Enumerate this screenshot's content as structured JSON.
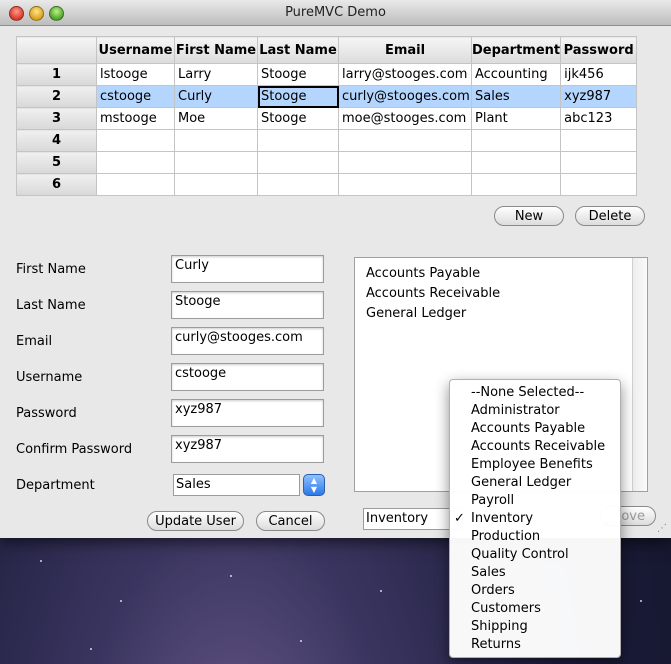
{
  "window": {
    "title": "PureMVC Demo"
  },
  "grid": {
    "headers": [
      "Username",
      "First Name",
      "Last Name",
      "Email",
      "Department",
      "Password"
    ],
    "row_numbers": [
      "1",
      "2",
      "3",
      "4",
      "5",
      "6"
    ],
    "rows": [
      [
        "lstooge",
        "Larry",
        "Stooge",
        "larry@stooges.com",
        "Accounting",
        "ijk456"
      ],
      [
        "cstooge",
        "Curly",
        "Stooge",
        "curly@stooges.com",
        "Sales",
        "xyz987"
      ],
      [
        "mstooge",
        "Moe",
        "Stooge",
        "moe@stooges.com",
        "Plant",
        "abc123"
      ],
      [
        "",
        "",
        "",
        "",
        "",
        ""
      ],
      [
        "",
        "",
        "",
        "",
        "",
        ""
      ],
      [
        "",
        "",
        "",
        "",
        "",
        ""
      ]
    ],
    "selected_row": 2
  },
  "grid_buttons": {
    "new": "New",
    "delete": "Delete"
  },
  "form": {
    "labels": {
      "first_name": "First Name",
      "last_name": "Last Name",
      "email": "Email",
      "username": "Username",
      "password": "Password",
      "confirm_password": "Confirm Password",
      "department": "Department"
    },
    "values": {
      "first_name": "Curly",
      "last_name": "Stooge",
      "email": "curly@stooges.com",
      "username": "cstooge",
      "password": "xyz987",
      "confirm_password": "xyz987",
      "department": "Sales"
    },
    "update_button": "Update User",
    "cancel_button": "Cancel"
  },
  "roles": {
    "assigned": [
      "Accounts Payable",
      "Accounts Receivable",
      "General Ledger"
    ],
    "selected_role": "Inventory",
    "remove_button_partial": "ove",
    "menu_items": [
      "--None Selected--",
      "Administrator",
      "Accounts Payable",
      "Accounts Receivable",
      "Employee Benefits",
      "General Ledger",
      "Payroll",
      "Inventory",
      "Production",
      "Quality Control",
      "Sales",
      "Orders",
      "Customers",
      "Shipping",
      "Returns"
    ],
    "checked_item": "Inventory",
    "check_glyph": "✓"
  }
}
